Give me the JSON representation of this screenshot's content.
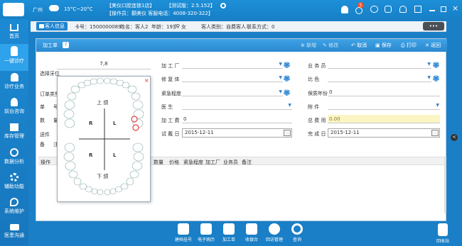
{
  "topbar": {
    "city": "广州",
    "weather": "15°C~20°C",
    "clinic": "【美仪口腔连锁1店】",
    "version": "【测试版：2.5.152】",
    "operator": "【操作员：颧美仪  客服电话：4008-320-322】",
    "notif_count": "5"
  },
  "sidebar": {
    "items": [
      {
        "label": "首页"
      },
      {
        "label": "一键诊疗"
      },
      {
        "label": "诊疗业务"
      },
      {
        "label": "前台咨询"
      },
      {
        "label": "库存管理"
      },
      {
        "label": "数据分析"
      },
      {
        "label": "辅助功能"
      },
      {
        "label": "系统维护"
      },
      {
        "label": "医患沟通"
      }
    ]
  },
  "infobar": {
    "tab": "客人信息",
    "card": "卡号：1500000089",
    "name": "姓名：客人2",
    "age": "年龄：19岁",
    "gender": "女",
    "category": "客人类别：自费客人",
    "contact": "联系方式：0",
    "more": "•••"
  },
  "panel": {
    "title": "加工单",
    "help": "?",
    "toolbar": {
      "add": "新增",
      "edit": "修改",
      "cancel": "取消",
      "save": "保存",
      "print": "打印",
      "back": "返回"
    },
    "left": {
      "tooth_select": "选择牙位",
      "order_type": "订单类型",
      "single_label": "单",
      "single_suffix": "号",
      "quantity_label": "数",
      "quantity_suffix": "量",
      "send_label": "送件",
      "remark_label": "备",
      "remark_suffix": "注",
      "tooth_input": "7,8"
    },
    "mid": {
      "factory": "加 工 厂",
      "repair": "修 复 体",
      "urgency": "紧急程度",
      "doctor": "医    生",
      "fee": "加 工 费",
      "fee_value": "0",
      "trial_date": "试 戴 日",
      "trial_value": "2015-12-11"
    },
    "right": {
      "salesman": "业 务 员",
      "color": "比    色",
      "warranty": "保质年份",
      "warranty_value": "0",
      "attachment": "附    件",
      "total_fee": "总 费 用",
      "total_value": "0.00",
      "done_date": "完 成 日",
      "done_value": "2015-12-11"
    },
    "table_headers": [
      "操作",
      "数量",
      "价格",
      "紧急程度",
      "加工厂",
      "业务员",
      "备注"
    ]
  },
  "tooth_chart": {
    "upper": "上 颌",
    "lower": "下 颌",
    "R": "R",
    "L": "L",
    "close": "×"
  },
  "bottombar": {
    "items": [
      {
        "label": "建档挂号"
      },
      {
        "label": "电子病历"
      },
      {
        "label": "加工单"
      },
      {
        "label": "收银台"
      },
      {
        "label": "回访管理"
      },
      {
        "label": "查询"
      }
    ],
    "recycle": "回收站"
  }
}
